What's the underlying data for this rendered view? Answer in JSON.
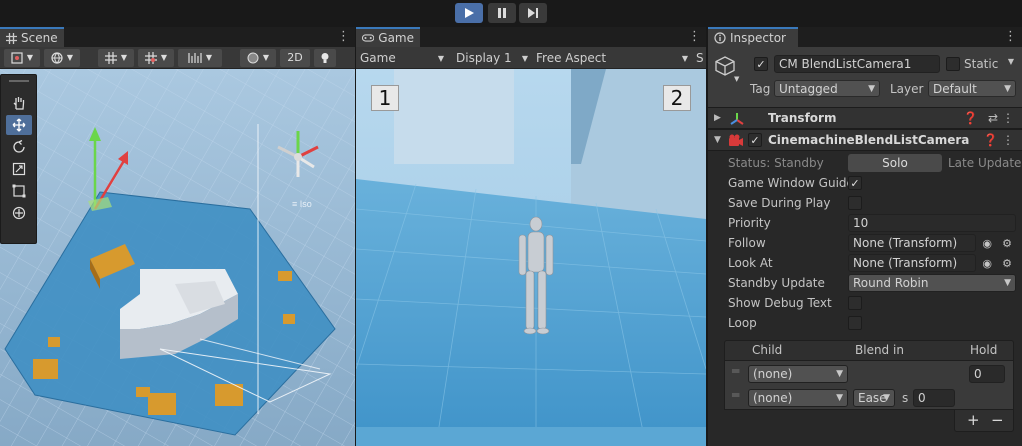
{
  "playbar": {
    "play": "play-icon",
    "pause": "pause-icon",
    "step": "step-icon"
  },
  "scene": {
    "tab_label": "Scene",
    "mode_2d": "2D",
    "orientation_label": "Iso"
  },
  "game": {
    "tab_label": "Game",
    "display_mode": "Game",
    "display": "Display 1",
    "aspect": "Free Aspect",
    "scale_prefix": "S",
    "camera_labels": [
      "1",
      "2"
    ]
  },
  "inspector": {
    "tab_label": "Inspector",
    "object_name": "CM BlendListCamera1",
    "static_label": "Static",
    "tag_label": "Tag",
    "tag_value": "Untagged",
    "layer_label": "Layer",
    "layer_value": "Default",
    "transform_label": "Transform",
    "component_label": "CinemachineBlendListCamera",
    "status_label": "Status: Standby",
    "solo_label": "Solo",
    "late_update_label": "Late Update",
    "props": {
      "game_window_guides": "Game Window Guides",
      "save_during_play": "Save During Play",
      "priority_label": "Priority",
      "priority_value": "10",
      "follow_label": "Follow",
      "follow_value": "None (Transform)",
      "look_at_label": "Look At",
      "look_at_value": "None (Transform)",
      "standby_update_label": "Standby Update",
      "standby_update_value": "Round Robin",
      "show_debug_text": "Show Debug Text",
      "loop_label": "Loop"
    },
    "list": {
      "col_child": "Child",
      "col_blend_in": "Blend in",
      "col_hold": "Hold",
      "rows": [
        {
          "child": "(none)",
          "hold": "0"
        },
        {
          "child": "(none)",
          "blend": "Ease",
          "unit": "s",
          "time": "0"
        }
      ],
      "add": "+",
      "remove": "−"
    }
  },
  "colors": {
    "accent": "#3a79bb",
    "play_active": "#4a6fa8",
    "panel_bg": "#282828",
    "toolbar_bg": "#383838",
    "sky": "#a9cde6",
    "floor": "#4f9fce"
  }
}
